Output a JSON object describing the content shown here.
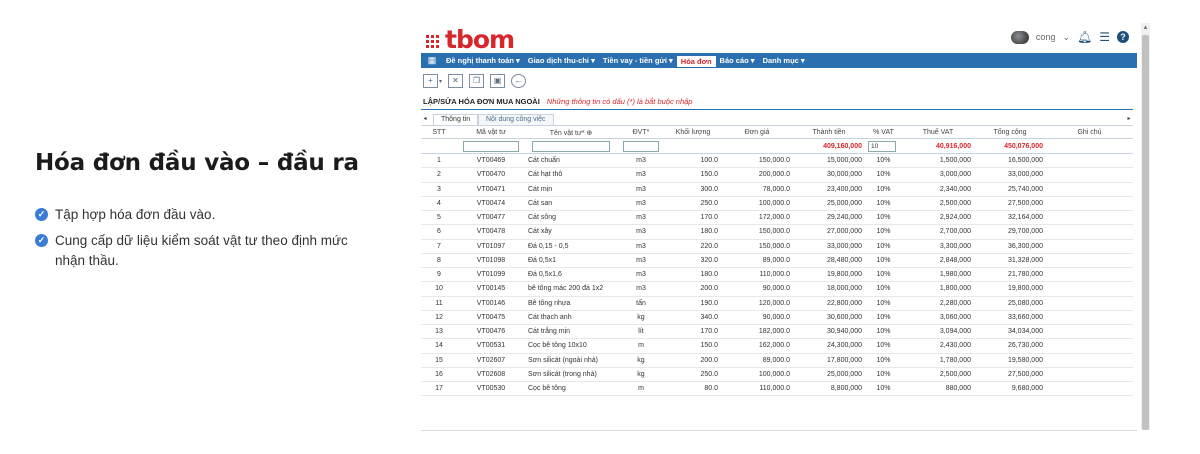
{
  "marketing": {
    "title": "Hóa đơn đầu vào – đầu ra",
    "bullets": [
      "Tập hợp hóa đơn đầu vào.",
      "Cung cấp dữ liệu kiểm soát vật tư theo định mức nhận thầu."
    ]
  },
  "app": {
    "logo": "tbom",
    "user": "cong",
    "icons": {
      "notification": "bell-icon",
      "list": "list-icon",
      "help": "help-icon"
    },
    "menu": [
      {
        "label": "Đề nghị thanh toán ▾",
        "active": false
      },
      {
        "label": "Giao dịch thu-chi ▾",
        "active": false
      },
      {
        "label": "Tiền vay - tiền gửi ▾",
        "active": false
      },
      {
        "label": "Hóa đơn",
        "active": true
      },
      {
        "label": "Báo cáo ▾",
        "active": false
      },
      {
        "label": "Danh mục ▾",
        "active": false
      }
    ],
    "form_title": "LẬP/SỬA HÓA ĐƠN MUA NGOÀI",
    "form_note": "Những thông tin có dấu (*) là bắt buộc nhập",
    "tabs": [
      "Thông tin",
      "Nội dung công việc"
    ]
  },
  "colors": {
    "accent": "#2a6fb0",
    "brand": "#d8262a"
  },
  "table": {
    "headers": [
      "STT",
      "Mã vật tư",
      "Tên vật tư* ⊕",
      "ĐVT*",
      "Khối lượng",
      "Đơn giá",
      "Thành tiền",
      "% VAT",
      "Thuế VAT",
      "Tổng cộng",
      "Ghi chú"
    ],
    "totals": {
      "thanh_tien": "409,160,000",
      "vat": "10",
      "thue_vat": "40,916,000",
      "tong_cong": "450,076,000"
    },
    "rows": [
      [
        "1",
        "VT00469",
        "Cát chuẩn",
        "m3",
        "100.0",
        "150,000.0",
        "15,000,000",
        "10%",
        "1,500,000",
        "16,500,000",
        ""
      ],
      [
        "2",
        "VT00470",
        "Cát hạt thô",
        "m3",
        "150.0",
        "200,000.0",
        "30,000,000",
        "10%",
        "3,000,000",
        "33,000,000",
        ""
      ],
      [
        "3",
        "VT00471",
        "Cát mịn",
        "m3",
        "300.0",
        "78,000.0",
        "23,400,000",
        "10%",
        "2,340,000",
        "25,740,000",
        ""
      ],
      [
        "4",
        "VT00474",
        "Cát san",
        "m3",
        "250.0",
        "100,000.0",
        "25,000,000",
        "10%",
        "2,500,000",
        "27,500,000",
        ""
      ],
      [
        "5",
        "VT00477",
        "Cát sông",
        "m3",
        "170.0",
        "172,000.0",
        "29,240,000",
        "10%",
        "2,924,000",
        "32,164,000",
        ""
      ],
      [
        "6",
        "VT00478",
        "Cát xây",
        "m3",
        "180.0",
        "150,000.0",
        "27,000,000",
        "10%",
        "2,700,000",
        "29,700,000",
        ""
      ],
      [
        "7",
        "VT01097",
        "Đá 0,15 - 0,5",
        "m3",
        "220.0",
        "150,000.0",
        "33,000,000",
        "10%",
        "3,300,000",
        "36,300,000",
        ""
      ],
      [
        "8",
        "VT01098",
        "Đá 0,5x1",
        "m3",
        "320.0",
        "89,000.0",
        "28,480,000",
        "10%",
        "2,848,000",
        "31,328,000",
        ""
      ],
      [
        "9",
        "VT01099",
        "Đá 0,5x1,6",
        "m3",
        "180.0",
        "110,000.0",
        "19,800,000",
        "10%",
        "1,980,000",
        "21,780,000",
        ""
      ],
      [
        "10",
        "VT00145",
        "bê tông mác 200 đá 1x2",
        "m3",
        "200.0",
        "90,000.0",
        "18,000,000",
        "10%",
        "1,800,000",
        "19,800,000",
        ""
      ],
      [
        "11",
        "VT00146",
        "Bê tông nhựa",
        "tấn",
        "190.0",
        "120,000.0",
        "22,800,000",
        "10%",
        "2,280,000",
        "25,080,000",
        ""
      ],
      [
        "12",
        "VT00475",
        "Cát thạch anh",
        "kg",
        "340.0",
        "90,000.0",
        "30,600,000",
        "10%",
        "3,060,000",
        "33,660,000",
        ""
      ],
      [
        "13",
        "VT00476",
        "Cát trắng mịn",
        "lít",
        "170.0",
        "182,000.0",
        "30,940,000",
        "10%",
        "3,094,000",
        "34,034,000",
        ""
      ],
      [
        "14",
        "VT00531",
        "Cọc bê tông 10x10",
        "m",
        "150.0",
        "162,000.0",
        "24,300,000",
        "10%",
        "2,430,000",
        "26,730,000",
        ""
      ],
      [
        "15",
        "VT02607",
        "Sơn silicát (ngoài nhà)",
        "kg",
        "200.0",
        "89,000.0",
        "17,800,000",
        "10%",
        "1,780,000",
        "19,580,000",
        ""
      ],
      [
        "16",
        "VT02608",
        "Sơn silicát (trong nhà)",
        "kg",
        "250.0",
        "100,000.0",
        "25,000,000",
        "10%",
        "2,500,000",
        "27,500,000",
        ""
      ],
      [
        "17",
        "VT00530",
        "Cọc bê tông",
        "m",
        "80.0",
        "110,000.0",
        "8,800,000",
        "10%",
        "880,000",
        "9,680,000",
        ""
      ]
    ]
  }
}
